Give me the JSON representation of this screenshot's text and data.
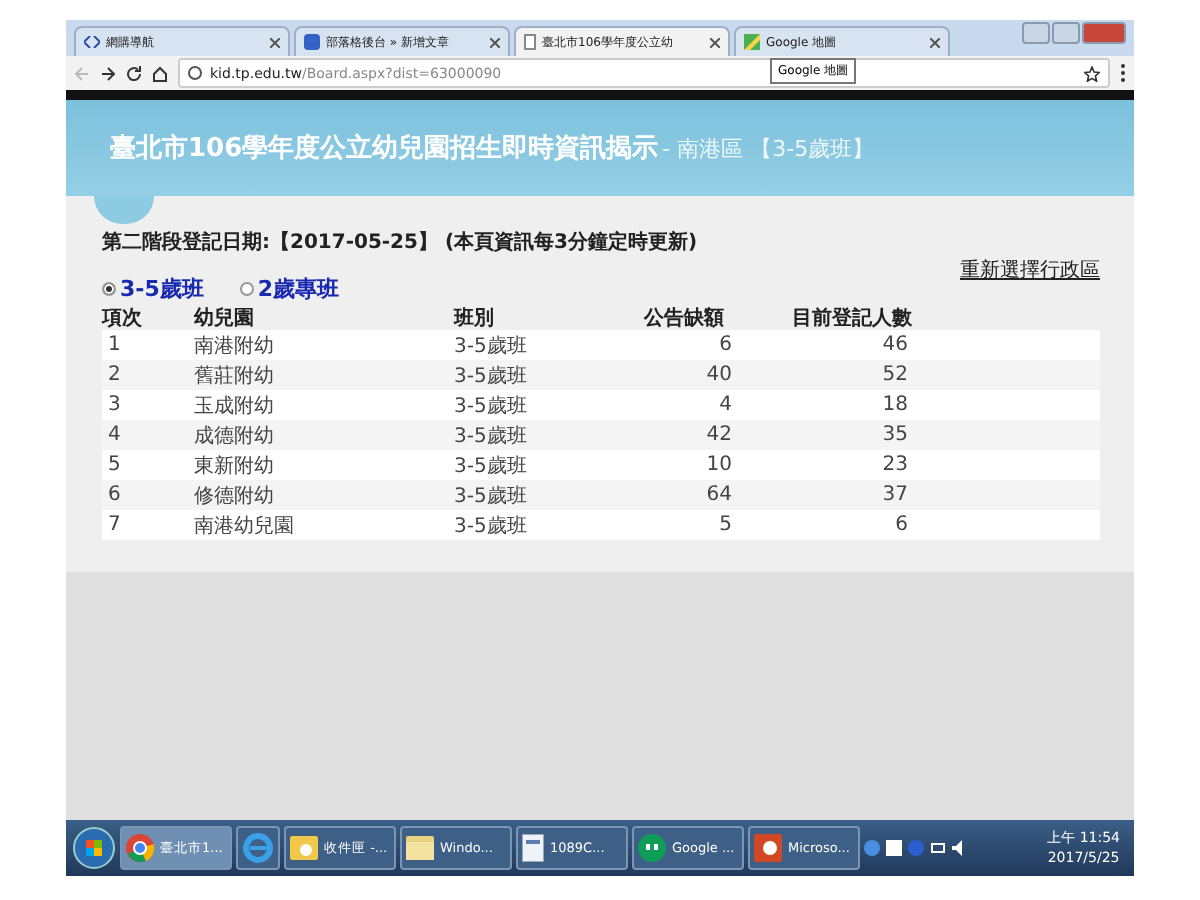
{
  "browser": {
    "tabs": [
      {
        "label": "網購導航",
        "selected": false,
        "kind": "code"
      },
      {
        "label": "部落格後台 » 新增文章",
        "selected": false,
        "kind": "blog"
      },
      {
        "label": "臺北市106學年度公立幼",
        "selected": true,
        "kind": "page"
      },
      {
        "label": "Google 地圖",
        "selected": false,
        "kind": "maps"
      }
    ],
    "tooltip": "Google 地圖",
    "address": {
      "host": "kid.tp.edu.tw",
      "path": "/Board.aspx?dist=63000090"
    }
  },
  "header": {
    "title": "臺北市106學年度公立幼兒園招生即時資訊揭示",
    "subtitle": " - 南港區 【3-5歲班】"
  },
  "date_line": "第二階段登記日期:【2017-05-25】 (本頁資訊每3分鐘定時更新)",
  "reselect_link": "重新選擇行政區",
  "radios": [
    {
      "label": "3-5歲班",
      "selected": true
    },
    {
      "label": "2歲專班",
      "selected": false
    }
  ],
  "table": {
    "columns": [
      "項次",
      "幼兒園",
      "班別",
      "公告缺額",
      "目前登記人數"
    ],
    "rows": [
      [
        "1",
        "南港附幼",
        "3-5歲班",
        "6",
        "46"
      ],
      [
        "2",
        "舊莊附幼",
        "3-5歲班",
        "40",
        "52"
      ],
      [
        "3",
        "玉成附幼",
        "3-5歲班",
        "4",
        "18"
      ],
      [
        "4",
        "成德附幼",
        "3-5歲班",
        "42",
        "35"
      ],
      [
        "5",
        "東新附幼",
        "3-5歲班",
        "10",
        "23"
      ],
      [
        "6",
        "修德附幼",
        "3-5歲班",
        "64",
        "37"
      ],
      [
        "7",
        "南港幼兒園",
        "3-5歲班",
        "5",
        "6"
      ]
    ]
  },
  "taskbar": {
    "items": [
      {
        "label": "臺北市1...",
        "selected": true,
        "kind": "chrome"
      },
      {
        "selected": false,
        "kind": "ie"
      },
      {
        "label": "收件匣 -...",
        "selected": false,
        "kind": "mail"
      },
      {
        "label": "Windo...",
        "selected": false,
        "kind": "folder"
      },
      {
        "label": "1089C...",
        "selected": false,
        "kind": "doc"
      },
      {
        "label": "Google ...",
        "selected": false,
        "kind": "hangouts"
      },
      {
        "label": "Microso...",
        "selected": false,
        "kind": "ppt"
      }
    ],
    "clock": {
      "time": "上午 11:54",
      "date": "2017/5/25"
    }
  }
}
